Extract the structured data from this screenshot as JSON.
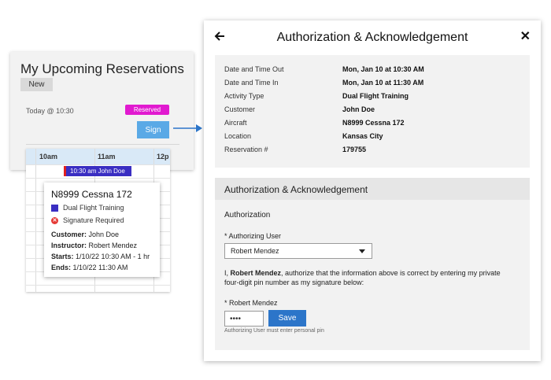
{
  "left_panel": {
    "title": "My Upcoming Reservations",
    "new_button": "New",
    "reservation_time": "Today @ 10:30",
    "status_badge": "Reserved",
    "sign_button": "Sign"
  },
  "schedule": {
    "hours": [
      "10am",
      "11am",
      "12p"
    ],
    "reservation_bar": "10:30 am John Doe"
  },
  "popup": {
    "aircraft": "N8999 Cessna 172",
    "activity": "Dual Flight Training",
    "signature_status": "Signature Required",
    "rows": [
      {
        "label": "Customer:",
        "value": "John Doe"
      },
      {
        "label": "Instructor:",
        "value": "Robert Mendez"
      },
      {
        "label": "Starts:",
        "value": "1/10/22 10:30 AM - 1 hr"
      },
      {
        "label": "Ends:",
        "value": "1/10/22 11:30 AM"
      }
    ]
  },
  "modal": {
    "title": "Authorization & Acknowledgement",
    "details": [
      {
        "label": "Date and Time Out",
        "value": "Mon, Jan 10 at 10:30 AM"
      },
      {
        "label": "Date and Time In",
        "value": "Mon, Jan 10 at 11:30 AM"
      },
      {
        "label": "Activity Type",
        "value": "Dual Flight Training"
      },
      {
        "label": "Customer",
        "value": "John Doe"
      },
      {
        "label": "Aircraft",
        "value": "N8999 Cessna 172"
      },
      {
        "label": "Location",
        "value": "Kansas City"
      },
      {
        "label": "Reservation #",
        "value": "179755"
      }
    ],
    "section_title": "Authorization & Acknowledgement",
    "subsection": "Authorization",
    "authorizing_user_label": "* Authorizing User",
    "authorizing_user_value": "Robert Mendez",
    "statement_name": "Robert Mendez",
    "statement_line1": ", authorize that the information above is correct by entering my private",
    "statement_line2": "four-digit pin number as my signature below:",
    "pin_label": "* Robert Mendez",
    "pin_value": "••••",
    "save_button": "Save",
    "helper_text": "Authorizing User must enter personal pin"
  },
  "colors": {
    "reserved_badge": "#e11ad0",
    "sign_button": "#5aa9e6",
    "reservation_bar": "#3a2ec2",
    "save_button": "#2c75c9",
    "arrow": "#2c75c9"
  }
}
